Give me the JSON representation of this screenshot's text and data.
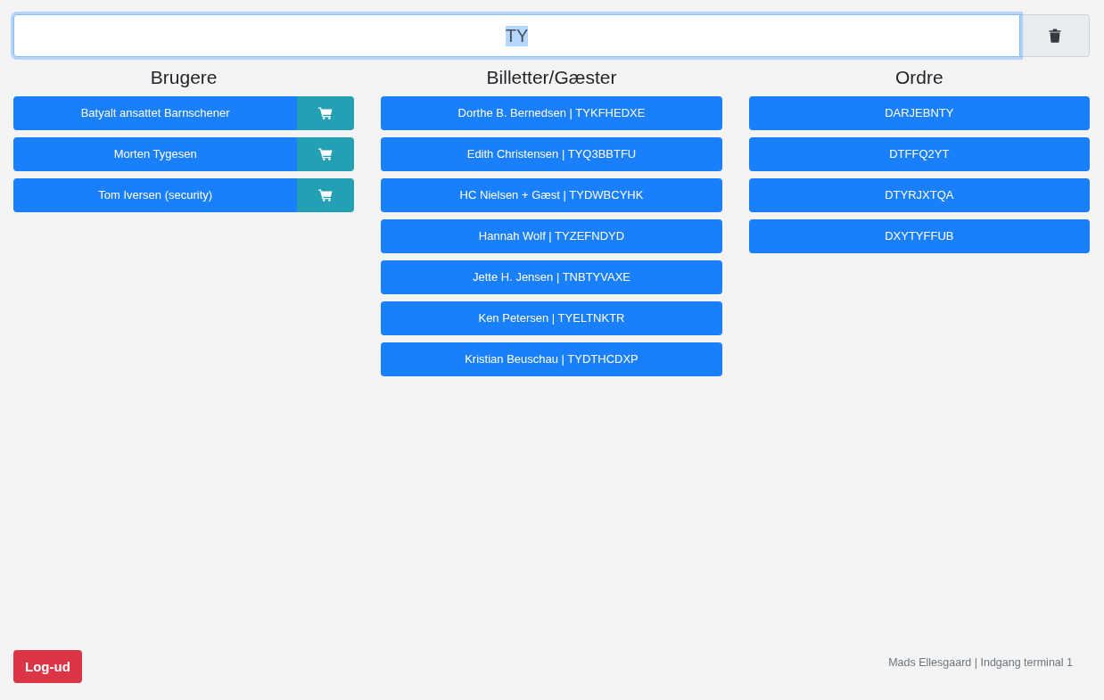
{
  "search": {
    "value": "TY",
    "text_selected": true,
    "focused": true
  },
  "columns": [
    {
      "title": "Brugere",
      "kind": "users",
      "items": [
        {
          "label": "Batyalt ansattet Barnschener"
        },
        {
          "label": "Morten Tygesen"
        },
        {
          "label": "Tom Iversen (security)"
        }
      ]
    },
    {
      "title": "Billetter/Gæster",
      "kind": "tickets",
      "items": [
        {
          "label": "Dorthe B. Bernedsen | TYKFHEDXE"
        },
        {
          "label": "Edith Christensen | TYQ3BBTFU"
        },
        {
          "label": "HC Nielsen + Gæst | TYDWBCYHK"
        },
        {
          "label": "Hannah Wolf | TYZEFNDYD"
        },
        {
          "label": "Jette H. Jensen | TNBTYVAXE"
        },
        {
          "label": "Ken Petersen | TYELTNKTR"
        },
        {
          "label": "Kristian Beuschau | TYDTHCDXP"
        }
      ]
    },
    {
      "title": "Ordre",
      "kind": "orders",
      "items": [
        {
          "label": "DARJEBNTY"
        },
        {
          "label": "DTFFQ2YT"
        },
        {
          "label": "DTYRJXTQA"
        },
        {
          "label": "DXYTYFFUB"
        }
      ]
    }
  ],
  "footer": {
    "logout_button": "Log-ud",
    "status": "Mads Ellesgaard | Indgang terminal 1"
  }
}
